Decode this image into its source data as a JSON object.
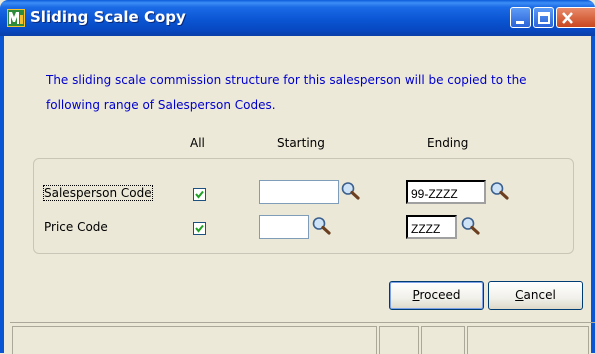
{
  "window": {
    "title": "Sliding Scale Copy",
    "icon": "mas90-app-icon",
    "controls": [
      "minimize-icon",
      "maximize-icon",
      "close-icon"
    ]
  },
  "description": "The sliding scale commission structure for this salesperson will be copied  to the following range of Salesperson Codes.",
  "columns": {
    "all": "All",
    "starting": "Starting",
    "ending": "Ending"
  },
  "rows": [
    {
      "label": "Salesperson Code",
      "all_checked": true,
      "starting_value": "",
      "ending_value": "99-ZZZZ"
    },
    {
      "label": "Price Code",
      "all_checked": true,
      "starting_value": "",
      "ending_value": "ZZZZ"
    }
  ],
  "buttons": {
    "proceed": "Proceed",
    "cancel": "Cancel"
  },
  "colors": {
    "title_bar": "#0a55d3",
    "description_text": "#0000cc",
    "dialog_bg": "#ece9d8"
  }
}
